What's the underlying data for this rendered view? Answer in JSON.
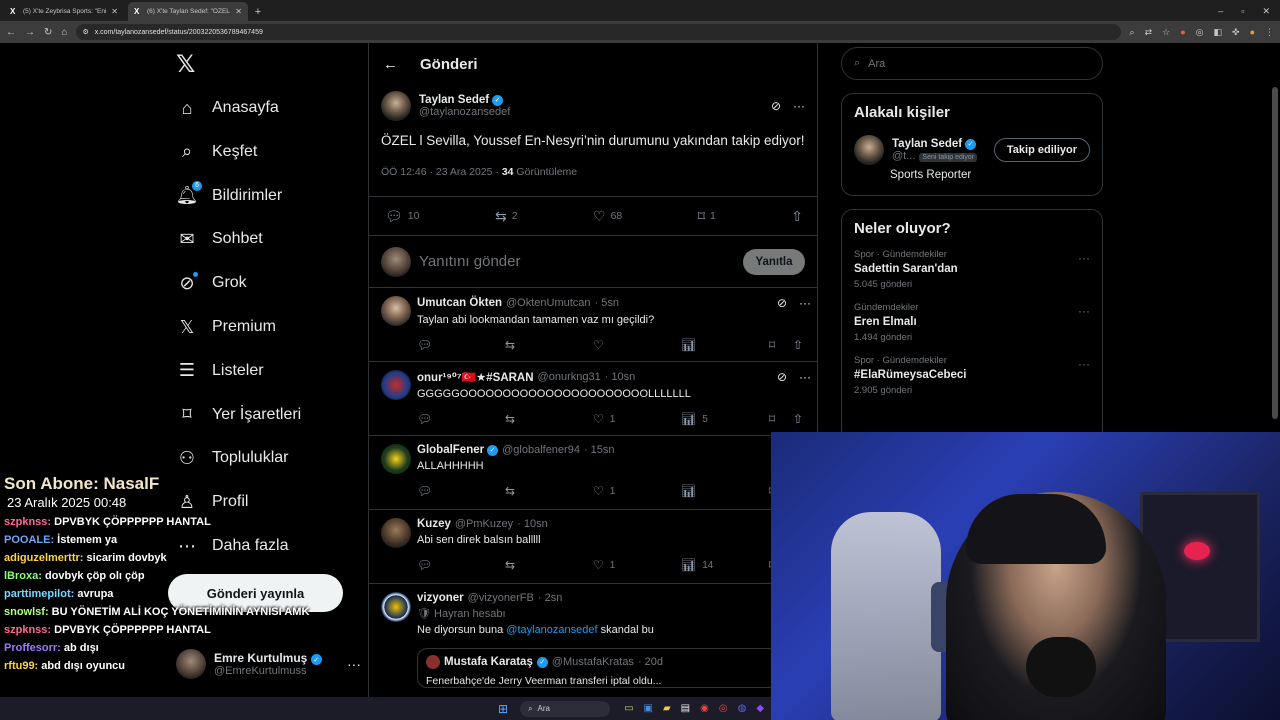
{
  "browser": {
    "tabs": [
      {
        "title": "(5) X'te Zeybrisa Sports: \"Eni...",
        "active": false
      },
      {
        "title": "(6) X'te Taylan Sedef: \"ÖZEL l Se...",
        "active": true
      }
    ],
    "url": "x.com/taylanozansedef/status/2003220536789467459"
  },
  "nav": {
    "items": [
      {
        "label": "Anasayfa",
        "icon": "home-icon"
      },
      {
        "label": "Keşfet",
        "icon": "search-icon"
      },
      {
        "label": "Bildirimler",
        "icon": "bell-icon",
        "badge": "6"
      },
      {
        "label": "Sohbet",
        "icon": "mail-icon"
      },
      {
        "label": "Grok",
        "icon": "grok-icon"
      },
      {
        "label": "Premium",
        "icon": "x-logo-icon"
      },
      {
        "label": "Listeler",
        "icon": "list-icon"
      },
      {
        "label": "Yer İşaretleri",
        "icon": "bookmark-icon"
      },
      {
        "label": "Topluluklar",
        "icon": "people-icon"
      },
      {
        "label": "Profil",
        "icon": "person-icon"
      },
      {
        "label": "Daha fazla",
        "icon": "more-circle-icon"
      }
    ],
    "post_button": "Gönderi yayınla",
    "account": {
      "name": "Emre Kurtulmuş",
      "handle": "@EmreKurtulmuss"
    }
  },
  "main": {
    "header": "Gönderi",
    "post": {
      "author": "Taylan Sedef",
      "handle": "@taylanozansedef",
      "text": "ÖZEL l Sevilla, Youssef En-Nesyri’nin durumunu yakından takip ediyor!",
      "time": "ÖÖ 12:46 · 23 Ara 2025 · ",
      "views": "34",
      "views_label": " Görüntüleme",
      "stats": {
        "replies": "10",
        "reposts": "2",
        "likes": "68",
        "bookmarks": "1"
      }
    },
    "reply_placeholder": "Yanıtını gönder",
    "reply_button": "Yanıtla",
    "comments": [
      {
        "name": "Umutcan Ökten",
        "handle": "@OktenUmutcan",
        "time": "· 5sn",
        "text": "Taylan abi lookmandan tamamen vaz mı geçildi?",
        "likes": "",
        "views": ""
      },
      {
        "name": "onur¹⁹⁰⁷🇹🇷★#SARAN",
        "handle": "@onurkng31",
        "time": "· 10sn",
        "text": "GGGGGOOOOOOOOOOOOOOOOOOOOOOLLLLLLL",
        "likes": "1",
        "views": "5"
      },
      {
        "name": "GlobalFener",
        "handle": "@globalfener94",
        "time": "· 15sn",
        "text": "ALLAHHHHH",
        "likes": "1",
        "views": ""
      },
      {
        "name": "Kuzey",
        "handle": "@PmKuzey",
        "time": "· 10sn",
        "text": "Abi sen direk balsın balllll",
        "likes": "1",
        "views": "14"
      },
      {
        "name": "vizyoner",
        "handle": "@vizyonerFB",
        "time": "· 2sn",
        "tag": "Hayran hesabı",
        "text_prefix": "Ne diyorsun buna ",
        "mention": "@taylanozansedef",
        "text_suffix": " skandal bu"
      }
    ],
    "quote": {
      "name": "Mustafa Karataş",
      "handle": "@MustafaKratas",
      "time": "· 20d",
      "text": "Fenerbahçe'de Jerry Veerman transferi iptal oldu..."
    }
  },
  "right": {
    "search_placeholder": "Ara",
    "related": {
      "title": "Alakalı kişiler",
      "name": "Taylan Sedef",
      "handle": "@t...",
      "follows_you": "Seni takip ediyor",
      "button": "Takip ediliyor",
      "bio": "Sports Reporter"
    },
    "trends": {
      "title": "Neler oluyor?",
      "items": [
        {
          "category": "Spor · Gündemdekiler",
          "name": "Sadettin Saran'dan",
          "count": "5.045 gönderi"
        },
        {
          "category": "Gündemdekiler",
          "name": "Eren Elmalı",
          "count": "1.494 gönderi"
        },
        {
          "category": "Spor · Gündemdekiler",
          "name": "#ElaRümeysaCebeci",
          "count": "2.905 gönderi"
        }
      ]
    }
  },
  "stream": {
    "last_sub": "Son Abone: NasalF",
    "date": "23 Aralık 2025   00:48",
    "chat": [
      {
        "user": "szpknss:",
        "color": "#ff6a9a",
        "msg": " DPVBYK ÇÖPPPPPP HANTAL"
      },
      {
        "user": "POOALE:",
        "color": "#6aa8ff",
        "msg": " İstemem ya"
      },
      {
        "user": "adiguzelmerttr:",
        "color": "#ffd23f",
        "msg": " sicarim dovbyk"
      },
      {
        "user": "lBroxa:",
        "color": "#8aff7a",
        "msg": " dovbyk çöp olı çöp"
      },
      {
        "user": "parttimepilot:",
        "color": "#7ad7ff",
        "msg": " avrupa"
      },
      {
        "user": "snowlsf:",
        "color": "#b3ff7a",
        "msg": " BU YÖNETİM ALİ KOÇ YÖNETİMİNİN AYNISI AMK"
      },
      {
        "user": "szpknss:",
        "color": "#ff6a9a",
        "msg": " DPVBYK ÇÖPPPPPP HANTAL"
      },
      {
        "user": "Proffesorr:",
        "color": "#9a7aff",
        "msg": " ab dışı"
      },
      {
        "user": "rftu99:",
        "color": "#ffd23f",
        "msg": " abd dışı oyuncu"
      }
    ]
  },
  "taskbar": {
    "search": "Ara"
  }
}
